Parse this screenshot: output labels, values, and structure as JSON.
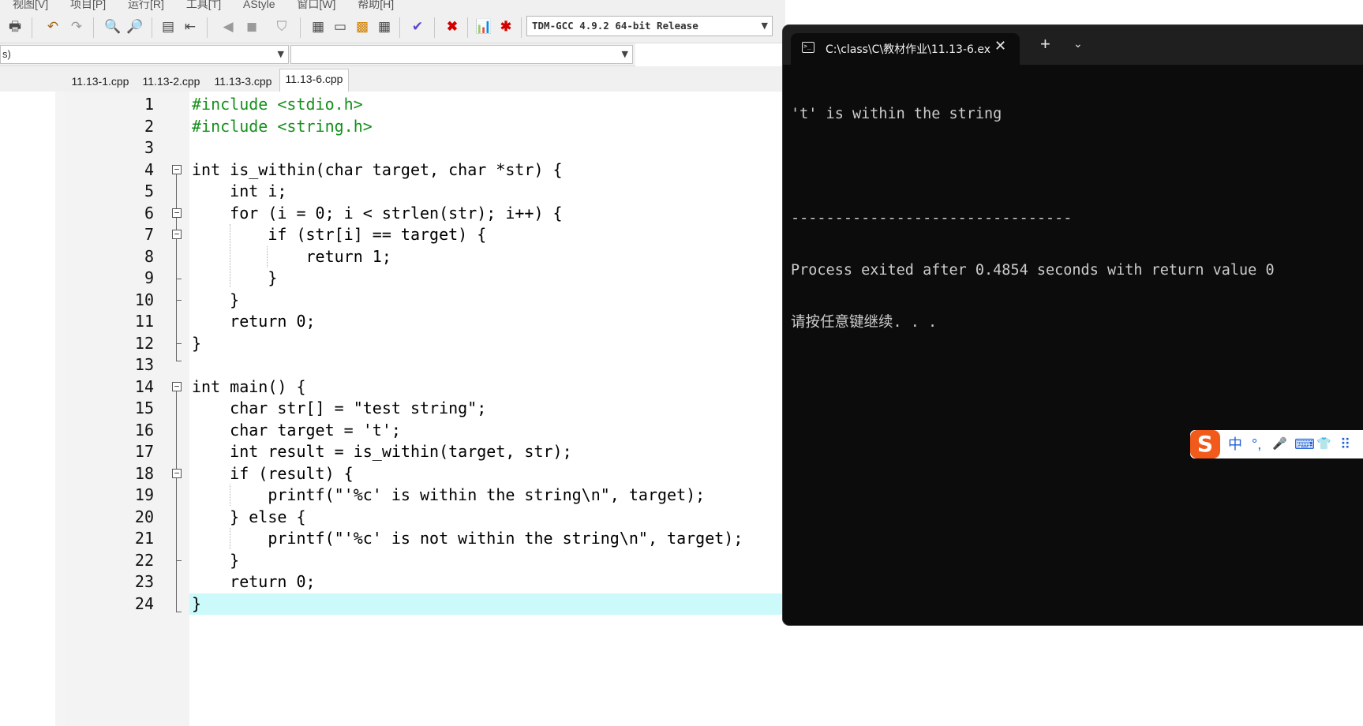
{
  "menu": [
    "视图[V]",
    "项目[P]",
    "运行[R]",
    "工具[T]",
    "AStyle",
    "窗口[W]",
    "帮助[H]"
  ],
  "toolbar": {
    "compiler": "TDM-GCC 4.9.2 64-bit Release"
  },
  "classbar": {
    "left_combo": "s)",
    "right_combo": ""
  },
  "tabs": [
    "11.13-1.cpp",
    "11.13-2.cpp",
    "11.13-3.cpp",
    "11.13-6.cpp"
  ],
  "active_tab": "11.13-6.cpp",
  "line_numbers": [
    "1",
    "2",
    "3",
    "4",
    "5",
    "6",
    "7",
    "8",
    "9",
    "10",
    "11",
    "12",
    "13",
    "14",
    "15",
    "16",
    "17",
    "18",
    "19",
    "20",
    "21",
    "22",
    "23",
    "24"
  ],
  "code_lines": [
    "#include <stdio.h>",
    "#include <string.h>",
    "",
    "int is_within(char target, char *str) {",
    "    int i;",
    "    for (i = 0; i < strlen(str); i++) {",
    "        if (str[i] == target) {",
    "            return 1;",
    "        }",
    "    }",
    "    return 0;",
    "}",
    "",
    "int main() {",
    "    char str[] = \"test string\";",
    "    char target = 't';",
    "    int result = is_within(target, str);",
    "    if (result) {",
    "        printf(\"'%c' is within the string\\n\", target);",
    "    } else {",
    "        printf(\"'%c' is not within the string\\n\", target);",
    "    }",
    "    return 0;",
    "}"
  ],
  "console": {
    "tab_title": "C:\\class\\C\\教材作业\\11.13-6.ex",
    "close_glyph": "✕",
    "new_tab_glyph": "+",
    "dropdown_glyph": "⌄",
    "lines": [
      "'t' is within the string",
      "",
      "--------------------------------",
      "Process exited after 0.4854 seconds with return value 0",
      "请按任意键继续. . ."
    ]
  },
  "ime": {
    "logo": "S",
    "items": [
      "中",
      "°,",
      "🎤",
      "⌨",
      "👕",
      "⠿"
    ]
  },
  "colors": {
    "preprocessor": "#16901c",
    "symbol": "#e00000",
    "number": "#8a3ea6",
    "string": "#1a1ae6",
    "current_line": "#ccfafa",
    "console_bg": "#0c0c0c",
    "console_text": "#cccccc"
  },
  "icons": [
    "print-icon",
    "undo-icon",
    "redo-icon",
    "find-icon",
    "replace-icon",
    "indent-icon",
    "unindent-icon",
    "bookmark-icon",
    "compile-icon",
    "run-icon",
    "compile-run-icon",
    "rebuild-icon",
    "check-icon",
    "stop-icon",
    "chart-icon",
    "debug-icon"
  ]
}
